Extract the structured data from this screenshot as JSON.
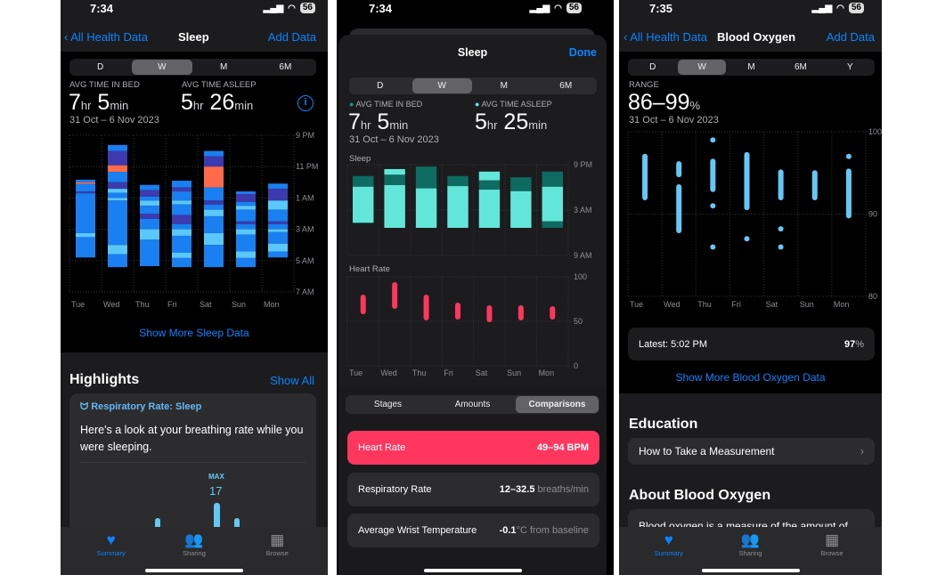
{
  "panels": [
    {
      "status": {
        "time": "7:34",
        "battery": "56"
      },
      "nav": {
        "back": "All Health Data",
        "title": "Sleep",
        "right": "Add Data"
      },
      "segments": [
        "D",
        "W",
        "M",
        "6M"
      ],
      "selected_segment": "W",
      "stat1": {
        "label": "AVG TIME IN BED",
        "h": "7",
        "hu": "hr",
        "m": "5",
        "mu": "min"
      },
      "stat2": {
        "label": "AVG TIME ASLEEP",
        "h": "5",
        "hu": "hr",
        "m": "26",
        "mu": "min"
      },
      "date_range": "31 Oct – 6 Nov 2023",
      "show_more": "Show More Sleep Data",
      "highlights": {
        "title": "Highlights",
        "show_all": "Show All",
        "card_title": "Respiratory Rate: Sleep",
        "card_text": "Here's a look at your breathing rate while you were sleeping.",
        "max_label": "MAX",
        "max_value": "17"
      },
      "tabs": [
        {
          "label": "Summary",
          "icon": "heart-icon",
          "active": true
        },
        {
          "label": "Sharing",
          "icon": "people-icon"
        },
        {
          "label": "Browse",
          "icon": "grid-icon"
        }
      ]
    },
    {
      "status": {
        "time": "7:34",
        "battery": "56"
      },
      "title": "Sleep",
      "done": "Done",
      "segments": [
        "D",
        "W",
        "M",
        "6M"
      ],
      "selected_segment": "W",
      "stat1": {
        "label": "AVG TIME IN BED",
        "h": "7",
        "hu": "hr",
        "m": "5",
        "mu": "min"
      },
      "stat2": {
        "label": "AVG TIME ASLEEP",
        "h": "5",
        "hu": "hr",
        "m": "25",
        "mu": "min"
      },
      "date_range": "31 Oct – 6 Nov 2023",
      "sleep_label": "Sleep",
      "hr_label": "Heart Rate",
      "bottom_tabs": [
        "Stages",
        "Amounts",
        "Comparisons"
      ],
      "selected_bottom_tab": "Comparisons",
      "rows": [
        {
          "label": "Heart Rate",
          "value": "49–94 BPM",
          "unit": ""
        },
        {
          "label": "Respiratory Rate",
          "value": "12–32.5",
          "unit": " breaths/min"
        },
        {
          "label": "Average Wrist Temperature",
          "value": "-0.1",
          "unit": "°C from baseline"
        }
      ]
    },
    {
      "status": {
        "time": "7:35",
        "battery": "56"
      },
      "nav": {
        "back": "All Health Data",
        "title": "Blood Oxygen",
        "right": "Add Data"
      },
      "segments": [
        "D",
        "W",
        "M",
        "6M",
        "Y"
      ],
      "selected_segment": "W",
      "range_label": "RANGE",
      "range_value": "86–99",
      "range_unit": "%",
      "date_range": "31 Oct – 6 Nov 2023",
      "latest_label": "Latest: 5:02 PM",
      "latest_value": "97",
      "latest_unit": "%",
      "show_more": "Show More Blood Oxygen Data",
      "education_title": "Education",
      "education_item": "How to Take a Measurement",
      "about_title": "About Blood Oxygen",
      "about_text": "Blood oxygen is a measure of the amount of",
      "tabs": [
        {
          "label": "Summary",
          "icon": "heart-icon",
          "active": true
        },
        {
          "label": "Sharing",
          "icon": "people-icon"
        },
        {
          "label": "Browse",
          "icon": "grid-icon"
        }
      ]
    }
  ],
  "colors": {
    "accent": "#0a84ff",
    "awake": "#ff6b4a",
    "rem": "#5ac8fa",
    "core": "#1a7ff0",
    "deep": "#3c3aae",
    "inbed": "#0e6b62",
    "asleep": "#63e6da",
    "heart": "#ff375f",
    "spo2": "#64c8f5"
  },
  "chart_data": [
    {
      "type": "bar",
      "title": "",
      "categories": [
        "Tue",
        "Wed",
        "Thu",
        "Fri",
        "Sat",
        "Sun",
        "Mon"
      ],
      "y_ticks": [
        "9 PM",
        "11 PM",
        "1 AM",
        "3 AM",
        "5 AM",
        "7 AM"
      ],
      "ylim": [
        "21:00",
        "07:00"
      ],
      "series": [
        [
          [
            "core",
            "23:50",
            "00:00"
          ],
          [
            "awake",
            "00:00",
            "00:06"
          ],
          [
            "core",
            "00:06",
            "00:35"
          ],
          [
            "deep",
            "00:35",
            "00:42"
          ],
          [
            "core",
            "00:42",
            "03:15"
          ],
          [
            "rem",
            "03:15",
            "03:30"
          ],
          [
            "core",
            "03:30",
            "04:48"
          ]
        ],
        [
          [
            "core",
            "21:37",
            "22:00"
          ],
          [
            "deep",
            "22:00",
            "22:55"
          ],
          [
            "awake",
            "22:55",
            "23:20"
          ],
          [
            "core",
            "23:20",
            "00:00"
          ],
          [
            "deep",
            "00:00",
            "00:25"
          ],
          [
            "rem",
            "00:25",
            "00:40"
          ],
          [
            "core",
            "00:40",
            "01:00"
          ],
          [
            "rem",
            "01:00",
            "01:10"
          ],
          [
            "core",
            "01:10",
            "04:00"
          ],
          [
            "rem",
            "04:00",
            "04:35"
          ],
          [
            "core",
            "04:35",
            "05:25"
          ]
        ],
        [
          [
            "core",
            "00:10",
            "00:30"
          ],
          [
            "deep",
            "00:30",
            "00:55"
          ],
          [
            "core",
            "00:55",
            "01:10"
          ],
          [
            "rem",
            "01:10",
            "01:30"
          ],
          [
            "core",
            "01:30",
            "02:00"
          ],
          [
            "deep",
            "02:00",
            "02:20"
          ],
          [
            "core",
            "02:20",
            "03:00"
          ],
          [
            "rem",
            "03:00",
            "03:40"
          ],
          [
            "core",
            "03:40",
            "05:21"
          ]
        ],
        [
          [
            "core",
            "23:54",
            "00:20"
          ],
          [
            "deep",
            "00:20",
            "00:35"
          ],
          [
            "core",
            "00:35",
            "01:10"
          ],
          [
            "rem",
            "01:10",
            "01:25"
          ],
          [
            "core",
            "01:25",
            "02:05"
          ],
          [
            "deep",
            "02:05",
            "02:40"
          ],
          [
            "core",
            "02:40",
            "03:00"
          ],
          [
            "rem",
            "03:00",
            "03:25"
          ],
          [
            "core",
            "03:25",
            "04:30"
          ],
          [
            "rem",
            "04:30",
            "04:50"
          ],
          [
            "core",
            "04:50",
            "05:25"
          ]
        ],
        [
          [
            "core",
            "22:00",
            "22:20"
          ],
          [
            "deep",
            "22:20",
            "23:00"
          ],
          [
            "awake",
            "23:00",
            "00:20"
          ],
          [
            "core",
            "00:20",
            "01:10"
          ],
          [
            "deep",
            "01:10",
            "01:25"
          ],
          [
            "core",
            "01:25",
            "01:45"
          ],
          [
            "rem",
            "01:45",
            "02:10"
          ],
          [
            "core",
            "02:10",
            "03:15"
          ],
          [
            "rem",
            "03:15",
            "04:00"
          ],
          [
            "core",
            "04:00",
            "05:25"
          ]
        ],
        [
          [
            "core",
            "00:35",
            "00:45"
          ],
          [
            "deep",
            "00:45",
            "01:15"
          ],
          [
            "core",
            "01:15",
            "01:30"
          ],
          [
            "rem",
            "01:30",
            "01:45"
          ],
          [
            "core",
            "01:45",
            "02:30"
          ],
          [
            "deep",
            "02:30",
            "02:40"
          ],
          [
            "core",
            "02:40",
            "03:00"
          ],
          [
            "rem",
            "03:00",
            "03:20"
          ],
          [
            "core",
            "03:20",
            "04:25"
          ],
          [
            "rem",
            "04:25",
            "04:50"
          ],
          [
            "core",
            "04:50",
            "05:25"
          ]
        ],
        [
          [
            "core",
            "00:05",
            "00:25"
          ],
          [
            "deep",
            "00:25",
            "01:10"
          ],
          [
            "rem",
            "01:10",
            "01:45"
          ],
          [
            "core",
            "01:45",
            "02:30"
          ],
          [
            "deep",
            "02:30",
            "02:40"
          ],
          [
            "core",
            "02:40",
            "03:00"
          ],
          [
            "rem",
            "03:00",
            "03:10"
          ],
          [
            "core",
            "03:10",
            "03:55"
          ],
          [
            "rem",
            "03:55",
            "04:25"
          ],
          [
            "core",
            "04:25",
            "04:48"
          ]
        ]
      ]
    },
    {
      "type": "bar",
      "title": "Sleep",
      "categories": [
        "Tue",
        "Wed",
        "Thu",
        "Fri",
        "Sat",
        "Sun",
        "Mon"
      ],
      "y_ticks": [
        "9 PM",
        "3 AM",
        "9 AM"
      ],
      "ylim": [
        "21:00",
        "09:00"
      ],
      "series": [
        [
          [
            "inbed",
            "22:30",
            "23:55"
          ],
          [
            "asleep",
            "23:55",
            "04:40"
          ],
          [
            "inbed",
            "04:40",
            "04:46"
          ]
        ],
        [
          [
            "asleep",
            "21:35",
            "22:20"
          ],
          [
            "inbed",
            "22:20",
            "23:42"
          ],
          [
            "asleep",
            "23:42",
            "05:21"
          ]
        ],
        [
          [
            "inbed",
            "21:15",
            "00:08"
          ],
          [
            "asleep",
            "00:08",
            "05:21"
          ]
        ],
        [
          [
            "inbed",
            "22:30",
            "23:50"
          ],
          [
            "asleep",
            "23:50",
            "05:21"
          ]
        ],
        [
          [
            "asleep",
            "21:55",
            "23:05"
          ],
          [
            "inbed",
            "23:05",
            "00:18"
          ],
          [
            "asleep",
            "00:18",
            "05:21"
          ]
        ],
        [
          [
            "inbed",
            "22:40",
            "00:30"
          ],
          [
            "asleep",
            "00:30",
            "05:21"
          ]
        ],
        [
          [
            "inbed",
            "21:55",
            "23:55"
          ],
          [
            "asleep",
            "23:55",
            "04:30"
          ],
          [
            "inbed",
            "04:30",
            "05:21"
          ]
        ]
      ]
    },
    {
      "type": "bar",
      "title": "Heart Rate",
      "categories": [
        "Tue",
        "Wed",
        "Thu",
        "Fri",
        "Sat",
        "Sun",
        "Mon"
      ],
      "y_ticks": [
        "100",
        "50",
        "0"
      ],
      "ylim": [
        0,
        100
      ],
      "ranges": [
        [
          58,
          80
        ],
        [
          64,
          94
        ],
        [
          51,
          80
        ],
        [
          52,
          71
        ],
        [
          49,
          68
        ],
        [
          51,
          68
        ],
        [
          52,
          67
        ]
      ]
    },
    {
      "type": "scatter",
      "title": "",
      "categories": [
        "Tue",
        "Wed",
        "Thu",
        "Fri",
        "Sat",
        "Sun",
        "Mon"
      ],
      "y_ticks": [
        "100",
        "90",
        "80"
      ],
      "ylim": [
        80,
        100
      ],
      "ranges": [
        [
          [
            92,
            97
          ]
        ],
        [
          [
            94.8,
            96.1
          ],
          [
            88,
            93.3
          ]
        ],
        [
          [
            99,
            99
          ],
          [
            93,
            96.4
          ],
          [
            91,
            91
          ],
          [
            86,
            86
          ]
        ],
        [
          [
            90.8,
            97.2
          ],
          [
            87,
            87
          ]
        ],
        [
          [
            92,
            95.1
          ],
          [
            88.2,
            88.2
          ],
          [
            86,
            86
          ]
        ],
        [
          [
            92,
            95
          ]
        ],
        [
          [
            97,
            97
          ],
          [
            89.8,
            95.2
          ]
        ]
      ]
    }
  ]
}
